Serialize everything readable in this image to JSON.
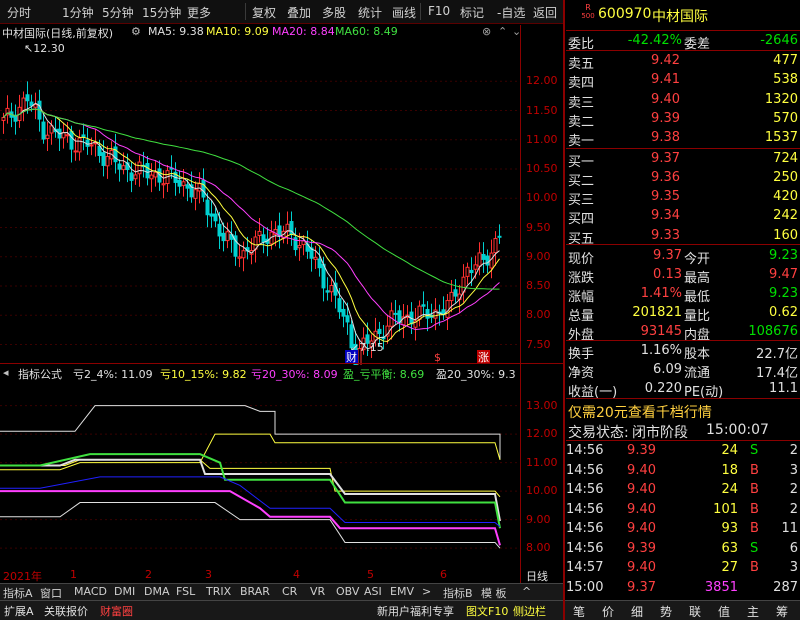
{
  "toolbar": {
    "items": [
      "分时",
      "1分钟",
      "5分钟",
      "15分钟",
      "更多",
      "复权",
      "叠加",
      "多股",
      "统计",
      "画线",
      "F10",
      "标记",
      "-自选",
      "返回"
    ]
  },
  "chart": {
    "title": "中材国际(日线,前复权)",
    "ma": [
      {
        "label": "MA5: 9.38",
        "color": "#e0e0e0"
      },
      {
        "label": "MA10: 9.09",
        "color": "#ffff40"
      },
      {
        "label": "MA20: 8.84",
        "color": "#ff40ff"
      },
      {
        "label": "MA60: 8.49",
        "color": "#40e040"
      }
    ],
    "high_label": "12.30",
    "low_label": "7.15",
    "y_labels": [
      "12.00",
      "11.50",
      "11.00",
      "10.50",
      "10.00",
      "9.50",
      "9.00",
      "8.50",
      "8.00",
      "7.50"
    ],
    "markers": [
      {
        "text": "财",
        "color": "#ffffff",
        "bg": "#0000c0"
      },
      {
        "text": "$",
        "color": "#ff4040",
        "bg": "#000000"
      },
      {
        "text": "涨",
        "color": "#ffffff",
        "bg": "#c00000"
      }
    ]
  },
  "indicator": {
    "title": "指标公式",
    "items": [
      {
        "label": "亏2_4%: 11.09",
        "color": "#e0e0e0"
      },
      {
        "label": "亏10_15%: 9.82",
        "color": "#ffff40"
      },
      {
        "label": "亏20_30%: 8.09",
        "color": "#ff40ff"
      },
      {
        "label": "盈_亏平衡: 8.69",
        "color": "#40e040"
      },
      {
        "label": "盈20_30%: 9.3",
        "color": "#e0e0e0"
      }
    ],
    "y_labels": [
      "13.00",
      "12.00",
      "11.00",
      "10.00",
      "9.00",
      "8.00"
    ]
  },
  "xaxis": {
    "labels": [
      "2021年",
      "1",
      "2",
      "3",
      "4",
      "5",
      "6"
    ],
    "right": "日线"
  },
  "tabs": [
    "指标A",
    "窗口",
    "MACD",
    "DMI",
    "DMA",
    "FSL",
    "TRIX",
    "BRAR",
    "CR",
    "VR",
    "OBV",
    "ASI",
    "EMV",
    ">",
    "指标B",
    "模 板",
    "^"
  ],
  "bottom": {
    "left": [
      "扩展A",
      "关联报价",
      "财富圈"
    ],
    "right": [
      "新用户福利专享",
      "图文F10",
      "侧边栏"
    ],
    "nav": [
      "笔",
      "价",
      "细",
      "势",
      "联",
      "值",
      "主",
      "筹"
    ]
  },
  "stock": {
    "code": "600970",
    "name": "中材国际",
    "badge_top": "R",
    "badge_bottom": "500"
  },
  "orderbook": {
    "weibi_label": "委比",
    "weibi": "-42.42%",
    "weicha_label": "委差",
    "weicha": "-2646",
    "sell": [
      {
        "label": "卖五",
        "price": "9.42",
        "vol": "477"
      },
      {
        "label": "卖四",
        "price": "9.41",
        "vol": "538"
      },
      {
        "label": "卖三",
        "price": "9.40",
        "vol": "1320"
      },
      {
        "label": "卖二",
        "price": "9.39",
        "vol": "570"
      },
      {
        "label": "卖一",
        "price": "9.38",
        "vol": "1537"
      }
    ],
    "buy": [
      {
        "label": "买一",
        "price": "9.37",
        "vol": "724"
      },
      {
        "label": "买二",
        "price": "9.36",
        "vol": "250"
      },
      {
        "label": "买三",
        "price": "9.35",
        "vol": "420"
      },
      {
        "label": "买四",
        "price": "9.34",
        "vol": "242"
      },
      {
        "label": "买五",
        "price": "9.33",
        "vol": "160"
      }
    ]
  },
  "quote": [
    {
      "l1": "现价",
      "v1": "9.37",
      "c1": "red",
      "l2": "今开",
      "v2": "9.23",
      "c2": "green"
    },
    {
      "l1": "涨跌",
      "v1": "0.13",
      "c1": "red",
      "l2": "最高",
      "v2": "9.47",
      "c2": "red"
    },
    {
      "l1": "涨幅",
      "v1": "1.41%",
      "c1": "red",
      "l2": "最低",
      "v2": "9.23",
      "c2": "green"
    },
    {
      "l1": "总量",
      "v1": "201821",
      "c1": "yel",
      "l2": "量比",
      "v2": "0.62",
      "c2": "yel"
    },
    {
      "l1": "外盘",
      "v1": "93145",
      "c1": "red",
      "l2": "内盘",
      "v2": "108676",
      "c2": "green"
    }
  ],
  "quote2": [
    {
      "l1": "换手",
      "v1": "1.16%",
      "l2": "股本",
      "v2": "22.7亿"
    },
    {
      "l1": "净资",
      "v1": "6.09",
      "l2": "流通",
      "v2": "17.4亿"
    },
    {
      "l1": "收益(一)",
      "v1": "0.220",
      "l2": "PE(动)",
      "v2": "11.1"
    }
  ],
  "promo": "仅需20元查看千档行情",
  "trade_status": {
    "label": "交易状态:",
    "status": "闭市阶段",
    "time": "15:00:07"
  },
  "ticks": [
    {
      "t": "14:56",
      "p": "9.39",
      "v": "24",
      "s": "S",
      "n": "2"
    },
    {
      "t": "14:56",
      "p": "9.40",
      "v": "18",
      "s": "B",
      "n": "3"
    },
    {
      "t": "14:56",
      "p": "9.40",
      "v": "24",
      "s": "B",
      "n": "2"
    },
    {
      "t": "14:56",
      "p": "9.40",
      "v": "101",
      "s": "B",
      "n": "2"
    },
    {
      "t": "14:56",
      "p": "9.40",
      "v": "93",
      "s": "B",
      "n": "11"
    },
    {
      "t": "14:56",
      "p": "9.39",
      "v": "63",
      "s": "S",
      "n": "6"
    },
    {
      "t": "14:57",
      "p": "9.40",
      "v": "27",
      "s": "B",
      "n": "3"
    },
    {
      "t": "15:00",
      "p": "9.37",
      "v": "3851",
      "s": "",
      "n": "287"
    }
  ]
}
